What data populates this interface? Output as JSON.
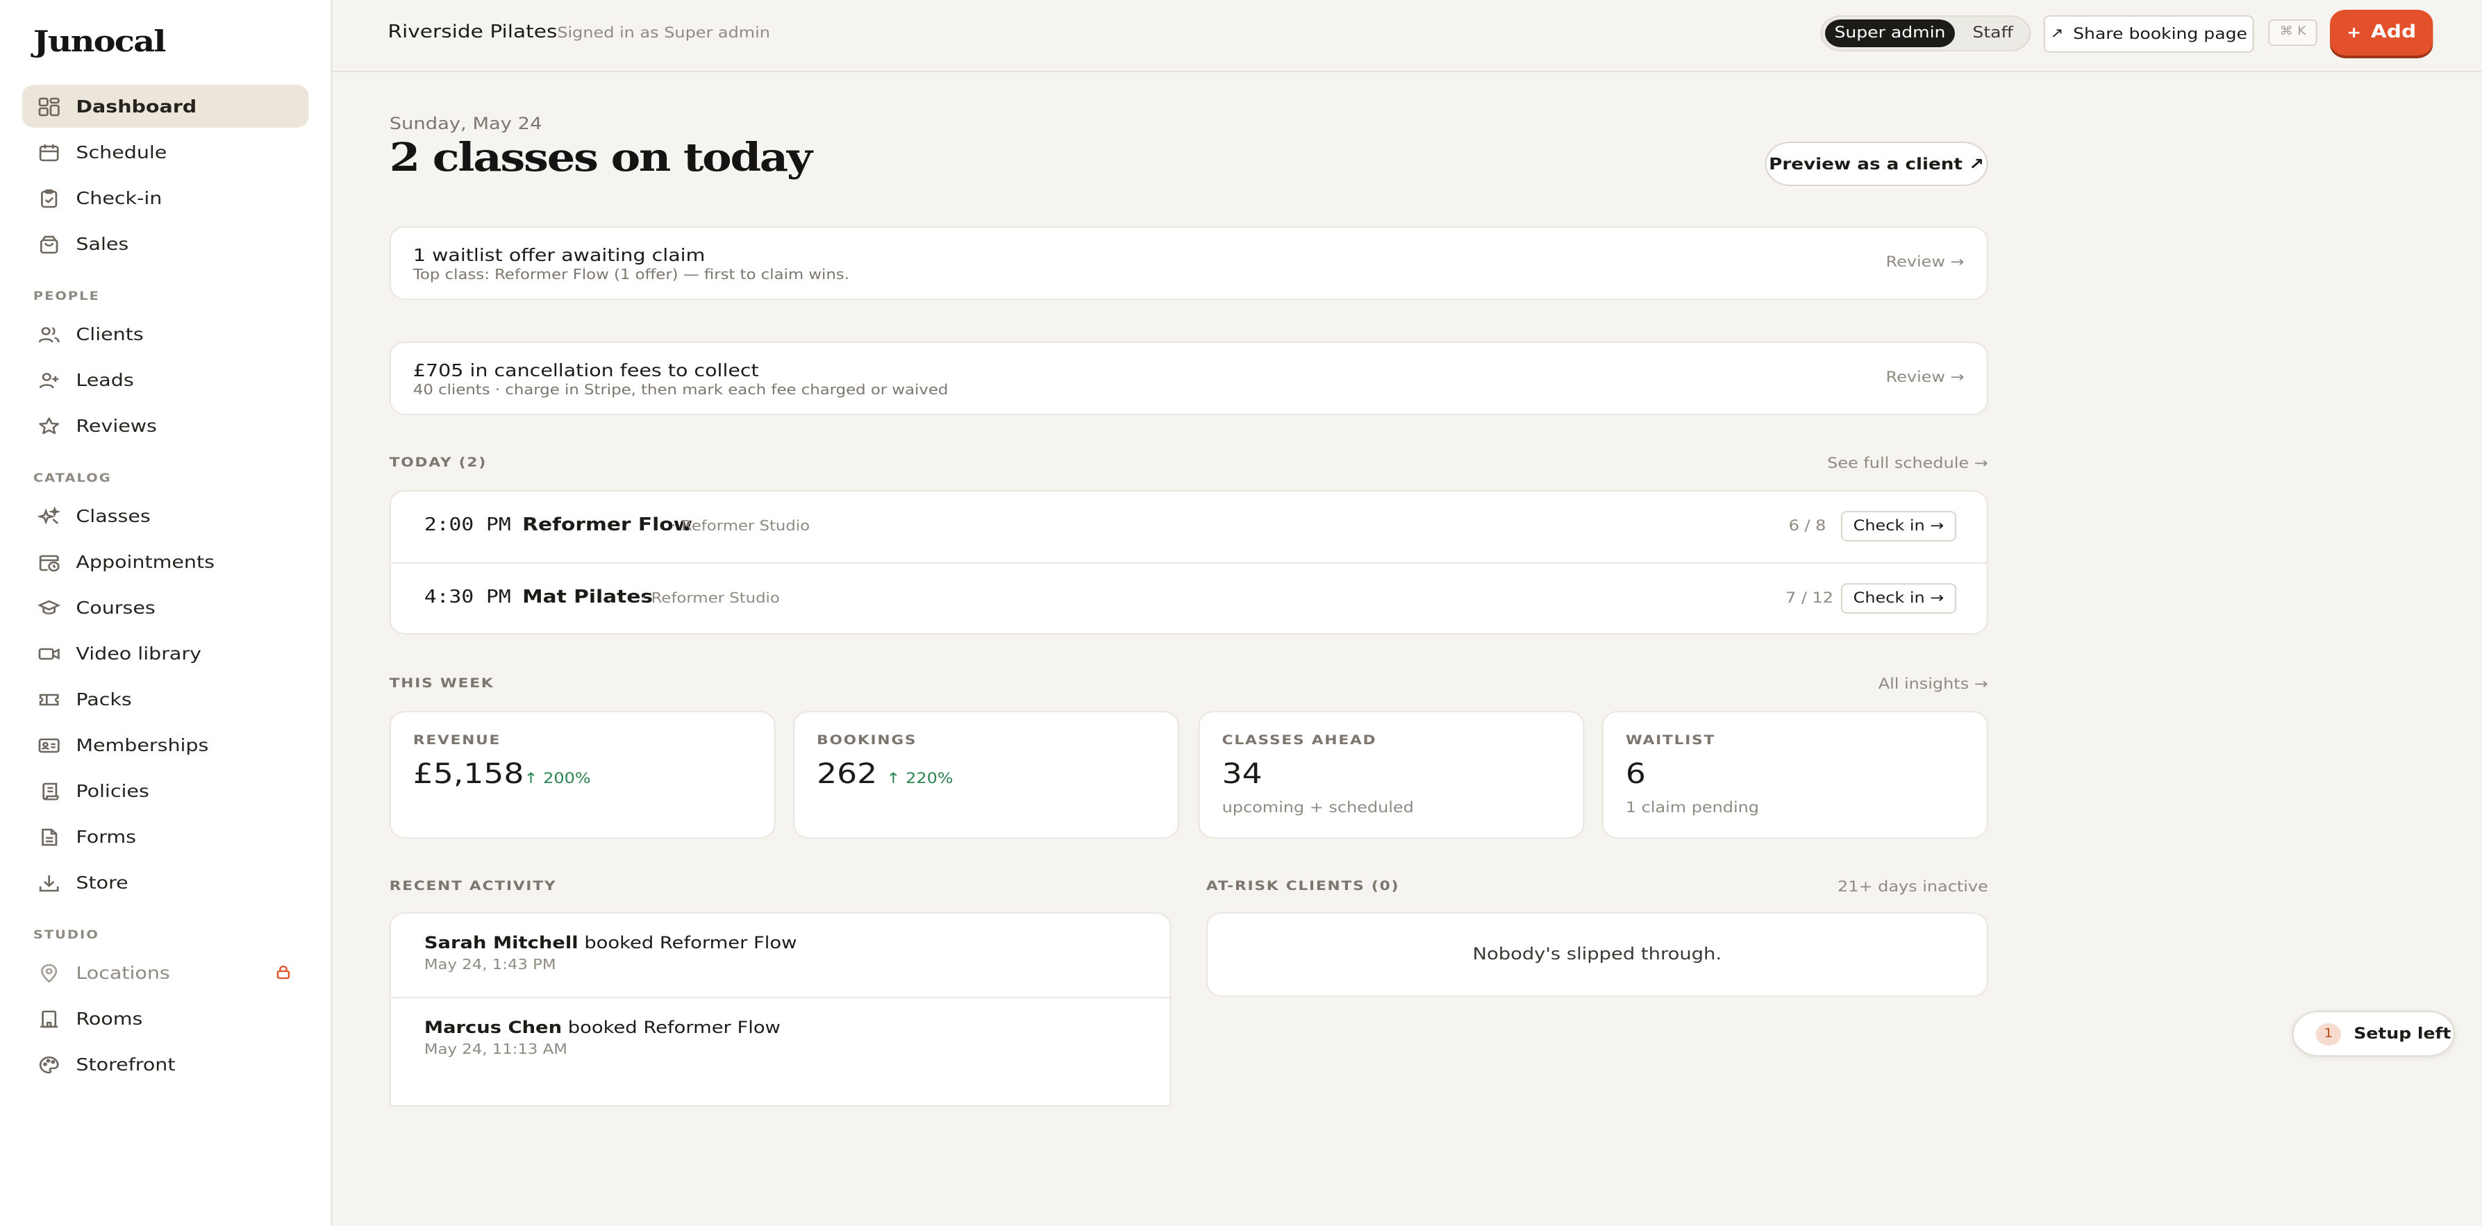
{
  "brand": {
    "logo": "Junocal"
  },
  "sidebar": {
    "main_items": [
      {
        "label": "Dashboard",
        "icon": "dashboard-icon",
        "active": true
      },
      {
        "label": "Schedule",
        "icon": "calendar-icon"
      },
      {
        "label": "Check-in",
        "icon": "clipboard-check-icon"
      },
      {
        "label": "Sales",
        "icon": "shopping-bag-icon"
      }
    ],
    "sections": [
      {
        "title": "PEOPLE",
        "items": [
          {
            "label": "Clients",
            "icon": "users-icon"
          },
          {
            "label": "Leads",
            "icon": "user-plus-icon"
          },
          {
            "label": "Reviews",
            "icon": "star-icon"
          }
        ]
      },
      {
        "title": "CATALOG",
        "items": [
          {
            "label": "Classes",
            "icon": "sparkle-icon"
          },
          {
            "label": "Appointments",
            "icon": "calendar-clock-icon"
          },
          {
            "label": "Courses",
            "icon": "graduation-cap-icon"
          },
          {
            "label": "Video library",
            "icon": "video-icon"
          },
          {
            "label": "Packs",
            "icon": "ticket-icon"
          },
          {
            "label": "Memberships",
            "icon": "id-card-icon"
          },
          {
            "label": "Policies",
            "icon": "scroll-icon"
          },
          {
            "label": "Forms",
            "icon": "document-icon"
          },
          {
            "label": "Store",
            "icon": "download-icon"
          }
        ]
      },
      {
        "title": "STUDIO",
        "items": [
          {
            "label": "Locations",
            "icon": "map-pin-icon",
            "locked": true
          },
          {
            "label": "Rooms",
            "icon": "building-icon"
          },
          {
            "label": "Storefront",
            "icon": "palette-icon"
          }
        ]
      }
    ]
  },
  "header": {
    "studio": "Riverside Pilates",
    "signed_in": "Signed in as Super admin",
    "roles": [
      "Super admin",
      "Staff"
    ],
    "active_role": "Super admin",
    "share_label": "Share booking page",
    "shortcut": "⌘ K",
    "add_label": "Add",
    "accent": "#e2512b"
  },
  "main": {
    "date": "Sunday, May 24",
    "headline": "2 classes on today",
    "preview_label": "Preview as a client ↗",
    "alerts": [
      {
        "title": "1 waitlist offer awaiting claim",
        "subtitle": "Top class: Reformer Flow (1 offer) — first to claim wins.",
        "action": "Review →"
      },
      {
        "title": "£705 in cancellation fees to collect",
        "subtitle": "40 clients · charge in Stripe, then mark each fee charged or waived",
        "action": "Review →"
      }
    ],
    "today": {
      "label": "TODAY (2)",
      "link": "See full schedule →",
      "classes": [
        {
          "time": "2:00 PM",
          "name": "Reformer Flow",
          "location": "· Reformer Studio",
          "capacity": "6 / 8",
          "action": "Check in →"
        },
        {
          "time": "4:30 PM",
          "name": "Mat Pilates",
          "location": "· Reformer Studio",
          "capacity": "7 / 12",
          "action": "Check in →"
        }
      ]
    },
    "week": {
      "label": "THIS WEEK",
      "link": "All insights →",
      "stats": [
        {
          "label": "REVENUE",
          "value": "£5,158",
          "delta": "200%"
        },
        {
          "label": "BOOKINGS",
          "value": "262",
          "delta": "220%"
        },
        {
          "label": "CLASSES AHEAD",
          "value": "34",
          "sub": "upcoming + scheduled"
        },
        {
          "label": "WAITLIST",
          "value": "6",
          "sub": "1 claim pending"
        }
      ]
    },
    "activity": {
      "label": "RECENT ACTIVITY",
      "items": [
        {
          "name": "Sarah Mitchell",
          "action": " booked Reformer Flow",
          "time": "May 24, 1:43 PM"
        },
        {
          "name": "Marcus Chen",
          "action": " booked Reformer Flow",
          "time": "May 24, 11:13 AM"
        }
      ]
    },
    "at_risk": {
      "label": "AT-RISK CLIENTS (0)",
      "note": "21+ days inactive",
      "empty": "Nobody's slipped through."
    }
  },
  "setup": {
    "count": "1",
    "label": "Setup left"
  }
}
